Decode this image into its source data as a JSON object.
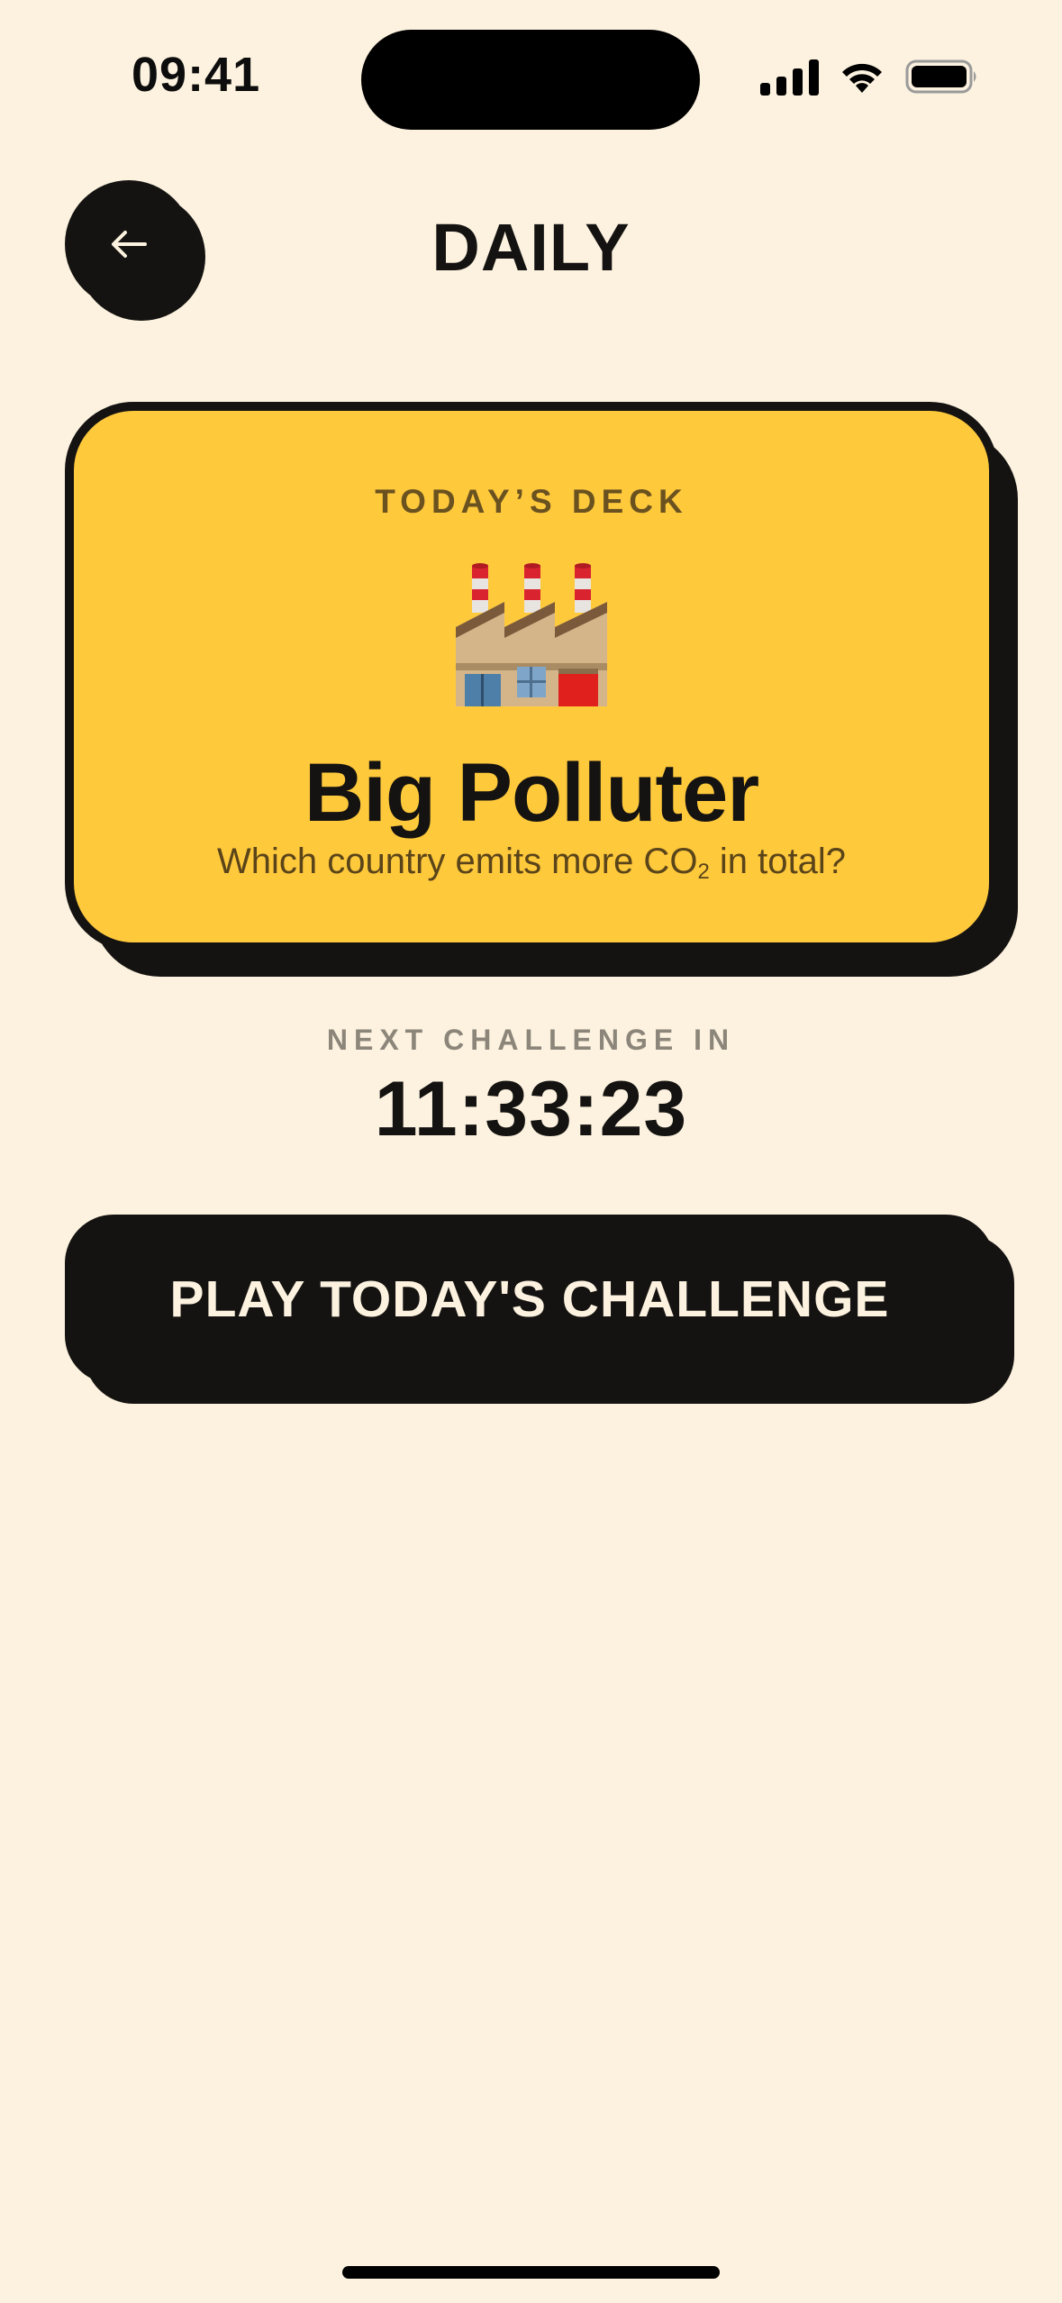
{
  "status_bar": {
    "time": "09:41",
    "icons": [
      "cellular-signal-icon",
      "wifi-icon",
      "battery-icon"
    ]
  },
  "header": {
    "back_icon": "arrow-left-icon",
    "title": "DAILY"
  },
  "deck": {
    "eyebrow": "TODAY’S DECK",
    "icon": "factory-icon",
    "name": "Big Polluter",
    "question_before": "Which country emits more CO",
    "question_sub": "2",
    "question_after": " in total?"
  },
  "countdown": {
    "label": "NEXT CHALLENGE IN",
    "value": "11:33:23"
  },
  "play_button": {
    "label": "PLAY TODAY'S CHALLENGE"
  },
  "colors": {
    "background": "#FCF2DF",
    "ink": "#151311",
    "card_yellow": "#FFC93C",
    "muted_label": "#8C857A"
  }
}
